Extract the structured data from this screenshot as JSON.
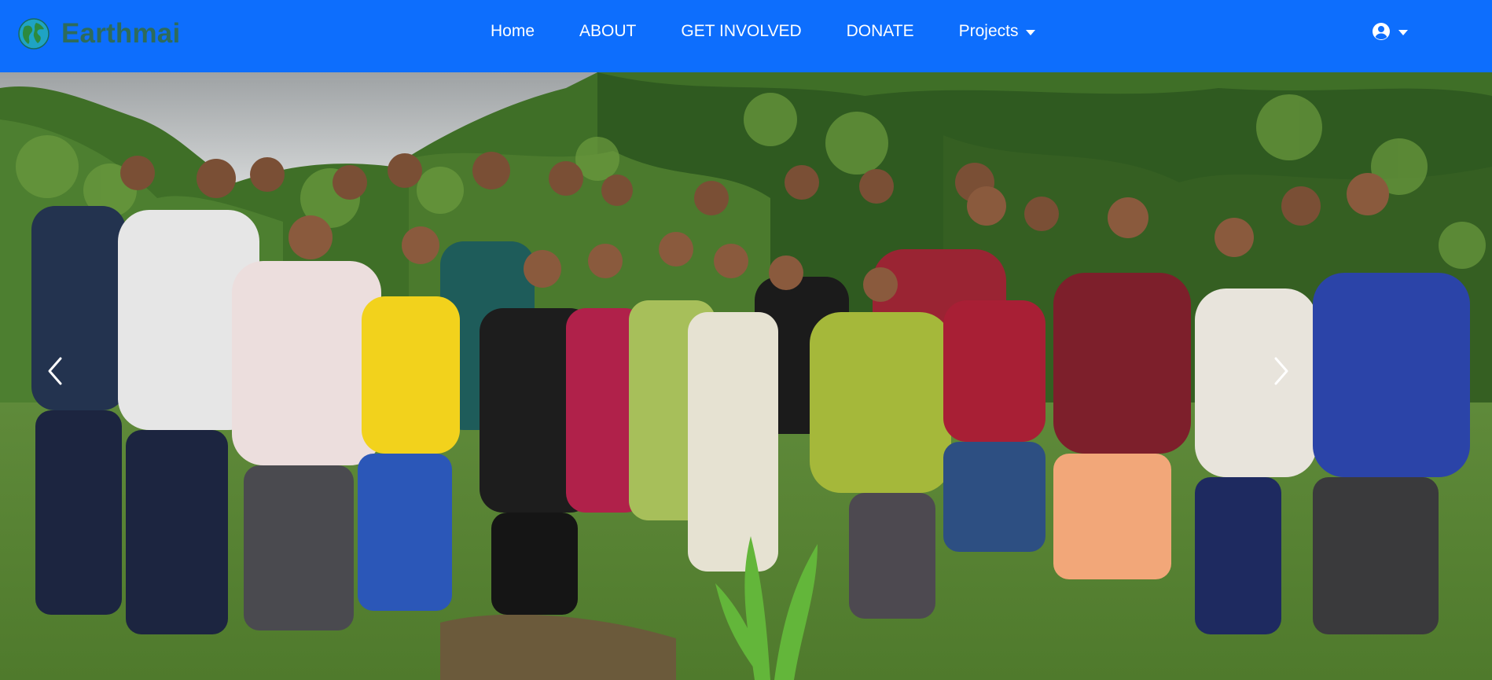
{
  "brand": {
    "name": "Earthmai",
    "logo_icon": "globe-icon"
  },
  "nav": {
    "items": [
      {
        "label": "Home"
      },
      {
        "label": "ABOUT"
      },
      {
        "label": "GET INVOLVED"
      },
      {
        "label": "DONATE"
      },
      {
        "label": "Projects",
        "dropdown": true
      }
    ]
  },
  "user_menu": {
    "icon": "user-circle-icon",
    "dropdown": true
  },
  "carousel": {
    "prev_icon": "chevron-left-icon",
    "next_icon": "chevron-right-icon",
    "slide_image": "group-photo-volunteers-in-forest"
  },
  "colors": {
    "navbar": "#0d6efd",
    "brand_text": "#2e6b5b",
    "nav_text": "#ffffff"
  }
}
